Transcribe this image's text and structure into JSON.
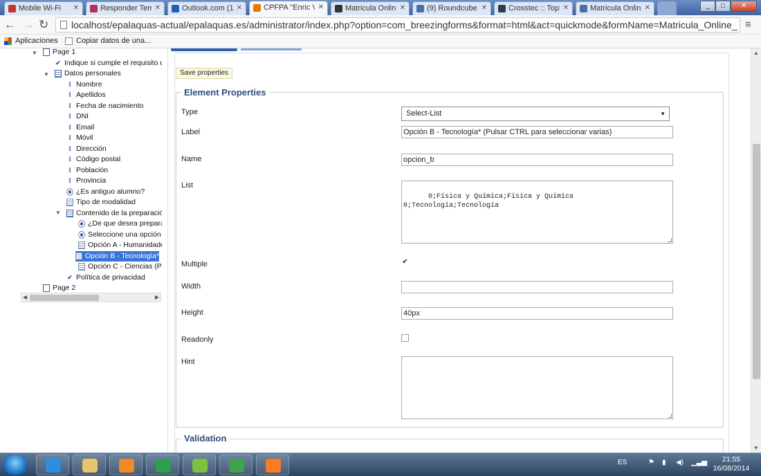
{
  "browser": {
    "tabs": [
      {
        "label": "Mobile Wi-Fi",
        "icon_color": "#c0392b"
      },
      {
        "label": "Responder Tem",
        "icon_color": "#b03060"
      },
      {
        "label": "Outlook.com (1",
        "icon_color": "#1f5fb4"
      },
      {
        "label": "CPFPA \"Enric V",
        "icon_color": "#e07b00"
      },
      {
        "label": "Matricula Onlin",
        "icon_color": "#333333"
      },
      {
        "label": "(9) Roundcube",
        "icon_color": "#4a6fa5"
      },
      {
        "label": "Crosstec :: Topi",
        "icon_color": "#2c3e50"
      },
      {
        "label": "Matricula Onlin",
        "icon_color": "#4a6fa5"
      }
    ],
    "active_tab": 3,
    "url": "localhost/epalaquas-actual/epalaquas.es/administrator/index.php?option=com_breezingforms&format=html&act=quickmode&formName=Matricula_Online_",
    "bookmarks": [
      {
        "label": "Aplicaciones",
        "icon": "apps-grid-icon"
      },
      {
        "label": "Copiar datos de una...",
        "icon": "page-icon"
      }
    ]
  },
  "tree": {
    "items": [
      {
        "label": "Page 1",
        "icon": "page",
        "level": 0
      },
      {
        "label": "Indique si cumple el requisito de ed",
        "icon": "check",
        "level": 1
      },
      {
        "label": "Datos personales",
        "icon": "section",
        "level": 1
      },
      {
        "label": "Nombre",
        "icon": "text",
        "level": 2
      },
      {
        "label": "Apellidos",
        "icon": "text",
        "level": 2
      },
      {
        "label": "Fecha de nacimiento",
        "icon": "text",
        "level": 2
      },
      {
        "label": "DNI",
        "icon": "text",
        "level": 2
      },
      {
        "label": "Email",
        "icon": "text",
        "level": 2
      },
      {
        "label": "Móvil",
        "icon": "text",
        "level": 2
      },
      {
        "label": "Dirección",
        "icon": "text",
        "level": 2
      },
      {
        "label": "Código postal",
        "icon": "text",
        "level": 2
      },
      {
        "label": "Población",
        "icon": "text",
        "level": 2
      },
      {
        "label": "Provincia",
        "icon": "text",
        "level": 2
      },
      {
        "label": "¿Es antiguo alumno?",
        "icon": "radio",
        "level": 2
      },
      {
        "label": "Tipo de modalidad",
        "icon": "list",
        "level": 2
      },
      {
        "label": "Contenido de la preparación:",
        "icon": "section",
        "level": 2
      },
      {
        "label": "¿De que desea prepararse",
        "icon": "radio",
        "level": 3
      },
      {
        "label": "Seleccione una opción (Ma",
        "icon": "radio",
        "level": 3
      },
      {
        "label": "Opción A - Humanidades (",
        "icon": "list",
        "level": 3
      },
      {
        "label": "Opción B - Tecnología* (P",
        "icon": "list",
        "level": 3,
        "selected": true
      },
      {
        "label": "Opción C - Ciencias (Pulsa",
        "icon": "list",
        "level": 3
      },
      {
        "label": "Política de privacidad",
        "icon": "check",
        "level": 2
      },
      {
        "label": "Page 2",
        "icon": "page",
        "level": 0
      }
    ]
  },
  "editor": {
    "save_label": "Save properties",
    "section_title": "Element Properties",
    "type_label": "Type",
    "type_value": "Select-List",
    "label_label": "Label",
    "label_value": "Opción B - Tecnología* (Pulsar CTRL para seleccionar varias)",
    "name_label": "Name",
    "name_value": "opcion_b",
    "list_label": "List",
    "list_value": "0;Física y Química;Física y Química\n0;Tecnología;Tecnología",
    "multiple_label": "Multiple",
    "multiple_checked": true,
    "width_label": "Width",
    "width_value": "",
    "height_label": "Height",
    "height_value": "40px",
    "readonly_label": "Readonly",
    "readonly_checked": false,
    "hint_label": "Hint",
    "hint_value": "",
    "validation_title": "Validation"
  },
  "taskbar": {
    "apps": [
      {
        "name": "internet-explorer-icon",
        "color": "#2a8fe0"
      },
      {
        "name": "file-explorer-icon",
        "color": "#e9c46a"
      },
      {
        "name": "media-player-icon",
        "color": "#f08a24"
      },
      {
        "name": "chrome-icon",
        "color": "#2e9e4f"
      },
      {
        "name": "notepad-icon",
        "color": "#7cc144"
      },
      {
        "name": "windows-update-icon",
        "color": "#3fa34d"
      },
      {
        "name": "xampp-icon",
        "color": "#fb7a24"
      }
    ],
    "language": "ES",
    "time": "21:55",
    "date": "16/08/2014"
  }
}
